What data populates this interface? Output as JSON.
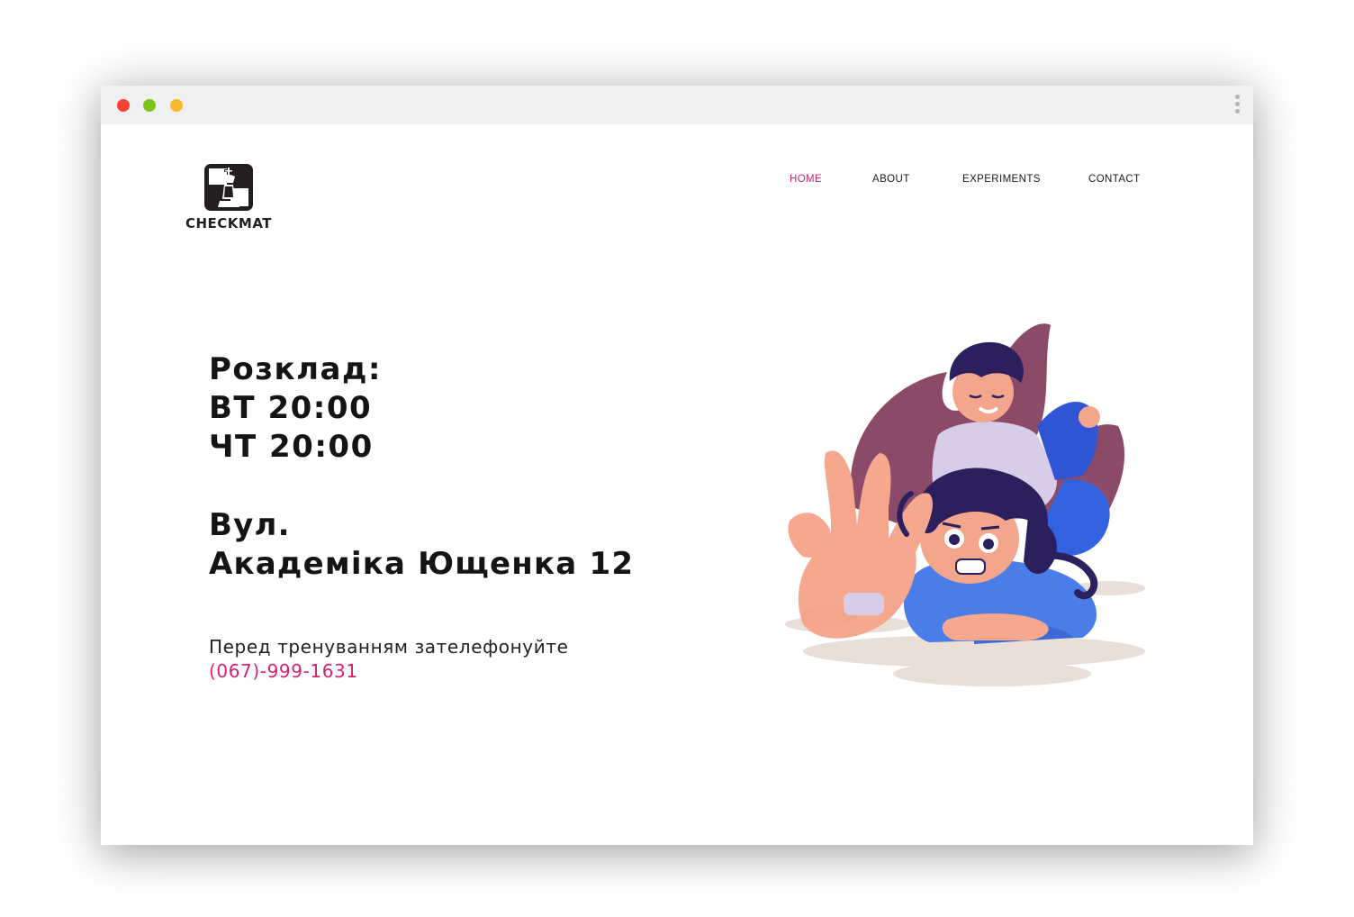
{
  "brand": {
    "name": "CHECKMAT",
    "icon": "chess-king-logo-icon"
  },
  "window": {
    "controls": [
      "close",
      "minimize",
      "maximize"
    ],
    "menu_icon": "kebab-menu-icon"
  },
  "nav": {
    "items": [
      {
        "label": "HOME",
        "active": true
      },
      {
        "label": "ABOUT",
        "active": false
      },
      {
        "label": "EXPERIMENTS",
        "active": false
      },
      {
        "label": "CONTACT",
        "active": false
      }
    ]
  },
  "schedule": {
    "heading": "Розклад:",
    "lines": [
      "ВТ 20:00",
      "ЧТ 20:00"
    ]
  },
  "address": {
    "line1": "Вул.",
    "line2": "Академіка Ющенка 12"
  },
  "contact": {
    "note": "Перед тренуванням зателефонуйте",
    "phone": "(067)-999-1631"
  },
  "colors": {
    "accent": "#d6246e",
    "text": "#141414",
    "titlebar": "#f0f0f0",
    "dot_red": "#f44336",
    "dot_green": "#7cc519",
    "dot_yellow": "#f8b92d"
  }
}
